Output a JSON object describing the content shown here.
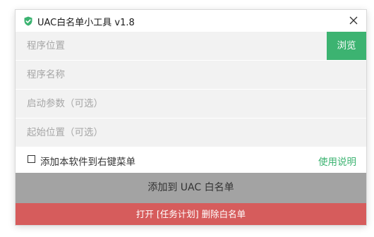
{
  "window": {
    "title": "UAC白名单小工具 v1.8",
    "app_icon": "shield-check-icon",
    "close_icon": "close-icon"
  },
  "form": {
    "program_path_placeholder": "程序位置",
    "program_path_value": "",
    "browse_label": "浏览",
    "program_name_placeholder": "程序名称",
    "program_name_value": "",
    "launch_args_placeholder": "启动参数（可选）",
    "launch_args_value": "",
    "start_dir_placeholder": "起始位置（可选）",
    "start_dir_value": ""
  },
  "options": {
    "context_menu_label": "添加本软件到右键菜单",
    "context_menu_checked": false,
    "help_label": "使用说明"
  },
  "actions": {
    "add_label": "添加到 UAC 白名单",
    "task_label": "打开 [任务计划] 删除白名单"
  },
  "colors": {
    "accent": "#3cb371",
    "add_button": "#a3a3a3",
    "danger": "#d65c5c",
    "field_bg": "#f2f2f2"
  }
}
